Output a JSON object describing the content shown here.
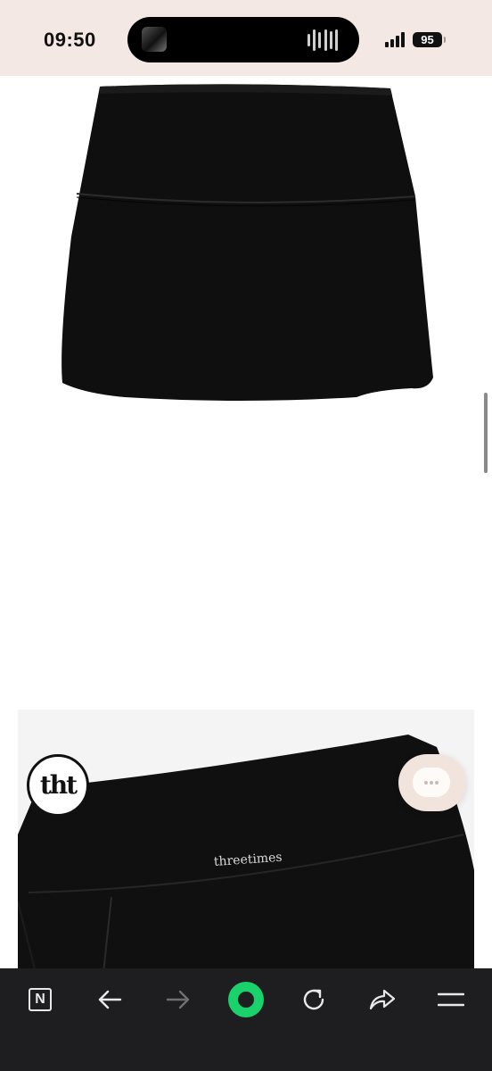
{
  "status_bar": {
    "time": "09:50",
    "battery": "95"
  },
  "product": {
    "brand_text": "threetimes",
    "logo_text": "tht"
  },
  "toolbar": {
    "items": [
      {
        "name": "home",
        "icon": "n-logo-icon"
      },
      {
        "name": "back",
        "icon": "arrow-left-icon"
      },
      {
        "name": "forward",
        "icon": "arrow-right-icon"
      },
      {
        "name": "green-dot",
        "icon": "green-circle-icon"
      },
      {
        "name": "reload",
        "icon": "reload-icon"
      },
      {
        "name": "share",
        "icon": "share-icon"
      },
      {
        "name": "menu",
        "icon": "hamburger-icon"
      }
    ],
    "home_label": "N"
  },
  "colors": {
    "status_bg": "#f3e8e3",
    "toolbar_bg": "#1e1e20",
    "accent_green": "#19d26b",
    "product_black": "#0f0f10"
  }
}
